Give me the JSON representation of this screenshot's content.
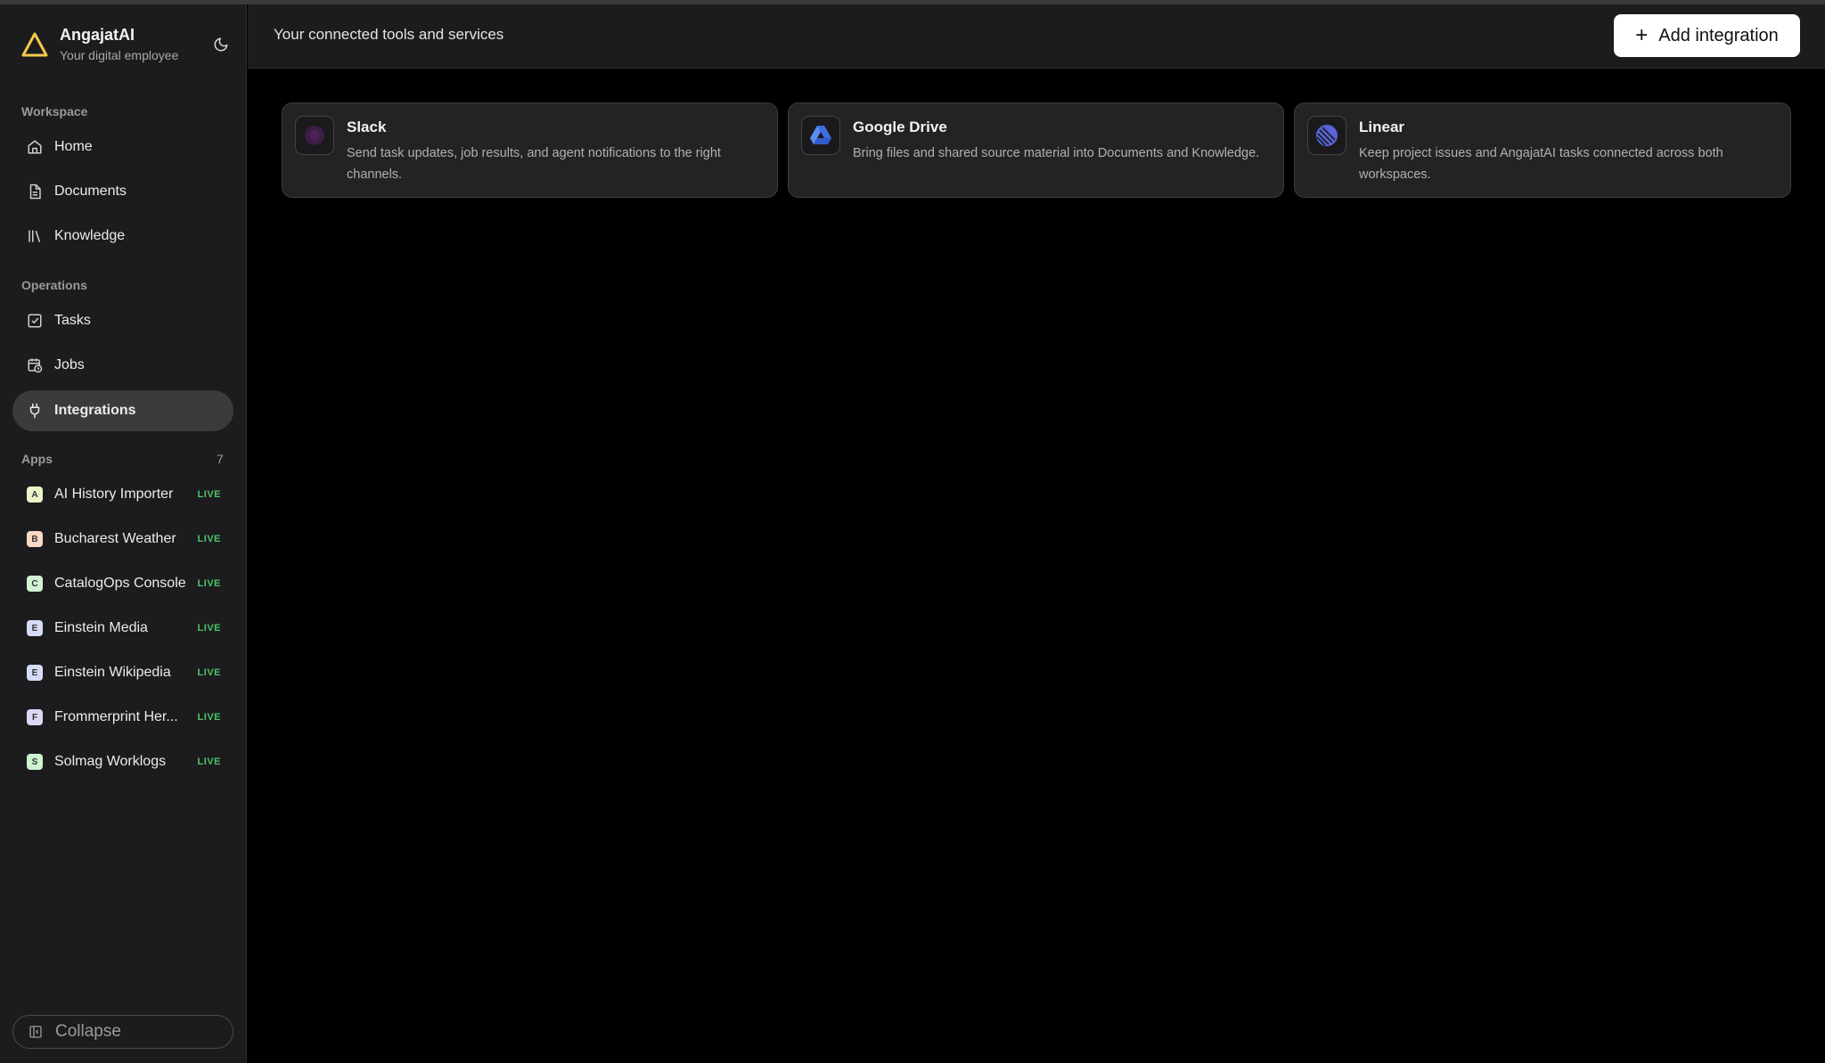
{
  "brand": {
    "name": "AngajatAI",
    "subtitle": "Your digital employee"
  },
  "sidebar": {
    "workspace_label": "Workspace",
    "workspace_items": [
      {
        "label": "Home",
        "icon": "home-icon"
      },
      {
        "label": "Documents",
        "icon": "document-icon"
      },
      {
        "label": "Knowledge",
        "icon": "library-icon"
      }
    ],
    "operations_label": "Operations",
    "operations_items": [
      {
        "label": "Tasks",
        "icon": "checkbox-icon"
      },
      {
        "label": "Jobs",
        "icon": "calendar-clock-icon"
      },
      {
        "label": "Integrations",
        "icon": "plug-icon",
        "active": true
      }
    ],
    "apps_label": "Apps",
    "apps_count": "7",
    "apps": [
      {
        "letter": "A",
        "label": "AI History Importer",
        "status": "LIVE",
        "color": "#e9f5c8"
      },
      {
        "letter": "B",
        "label": "Bucharest Weather",
        "status": "LIVE",
        "color": "#f7d9c4"
      },
      {
        "letter": "C",
        "label": "CatalogOps Console",
        "status": "LIVE",
        "color": "#d3f2d3"
      },
      {
        "letter": "E",
        "label": "Einstein Media",
        "status": "LIVE",
        "color": "#d6dcf7"
      },
      {
        "letter": "E",
        "label": "Einstein Wikipedia",
        "status": "LIVE",
        "color": "#d6dcf7"
      },
      {
        "letter": "F",
        "label": "Frommerprint Her...",
        "status": "LIVE",
        "color": "#dcd8f5"
      },
      {
        "letter": "S",
        "label": "Solmag Worklogs",
        "status": "LIVE",
        "color": "#cdf2cf"
      }
    ],
    "collapse_label": "Collapse"
  },
  "header": {
    "title": "Your connected tools and services",
    "add_button_label": "Add integration"
  },
  "integrations": [
    {
      "name": "Slack",
      "icon": "slack-icon",
      "description": "Send task updates, job results, and agent notifications to the right channels."
    },
    {
      "name": "Google Drive",
      "icon": "google-drive-icon",
      "description": "Bring files and shared source material into Documents and Knowledge."
    },
    {
      "name": "Linear",
      "icon": "linear-icon",
      "description": "Keep project issues and AngajatAI tasks connected across both workspaces."
    }
  ],
  "colors": {
    "accent_live": "#4cc36a",
    "logo_yellow": "#f2c94c",
    "sidebar_bg": "#1c1c1e",
    "main_bg": "#000000"
  }
}
